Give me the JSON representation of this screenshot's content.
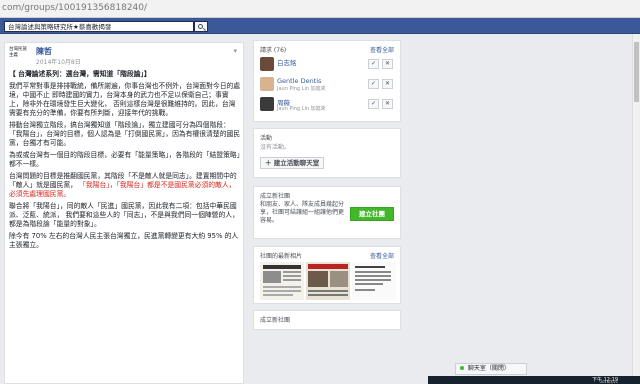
{
  "browser": {
    "url": "com/groups/100191356818240/"
  },
  "header": {
    "search_value": "台灣論述與策略研究所★蔡喜歡揭發"
  },
  "post": {
    "group_name": "台灣民族主義",
    "author": "陳哲",
    "date": "2014年10月8日",
    "paragraphs": [
      "【 台灣論述系列：選台灣，需知道「階段論」】",
      "我們平常對事是排排戰統，備所謝遍，你事台灣也不例外，台灣面對今日的處境，中國不止",
      "即時建國的實力，台灣本身的武力也不足以保衛自己；事實上，除非外在環境發生巨大變化，",
      "否則這樣台灣是很難維持的。因此，台灣需要有充分的準備，你要有所判斷，迎接年代的挑戰。",
      "排動台灣獨立階段，搞台灣獨知道「階段論」，獨立建國可分為四個階段：",
      "「我陽台」，台灣的目標，個人認為是「打倒國民黨」，因為有權很清楚的國民黨，台獨才有可能。",
      "為或或台灣有一個目的階段目標，必要有「能量策略」，各階段的「結盟策略」都不一樣。",
      "台灣問題的目標是推翻國民黨，其階段「不是敵人就是同志」。建置期間中的「敵人」就是國民黨，",
      "「我陽台」，「我陽台」都是不是國民黨必須的敵人，必須先處理國民黨。",
      "聯合將「我陽台」，同的敵人「民進」國民黨，因此我有二項：包括中華民國派、泛藍、統派，",
      "我們要和這些人的「同志」，不是與我們同一個陣營的人，都是為階段論「能量的對象」。",
      "除今有 70% 左右的台灣人民主張台灣獨立，民進黨轉變更有大約 95% 的人主張獨立。"
    ]
  },
  "invites": {
    "title": "請求 (76)",
    "see_all": "查看全部",
    "items": [
      {
        "name": "白志銘",
        "sub": ""
      },
      {
        "name": "Gentle Dentis",
        "sub": "Jaun Ping Lin 加進來"
      },
      {
        "name": "周薇",
        "sub": "Jaun Ping Lin 加進來"
      }
    ]
  },
  "events": {
    "title": "活動",
    "empty": "沒有活動。",
    "create_label": "建立活動聊天室"
  },
  "new_group": {
    "title": "成立新社團",
    "desc": "和朋友、家人、隊友成員幾起分享，社團可結讓組一組讓他們更容易。",
    "button": "建立社團"
  },
  "photos": {
    "title": "社團的最新相片",
    "see_all": "查看全部"
  },
  "tail": {
    "title": "成立新社團"
  },
  "chat": {
    "label": "聊天室（關閉）"
  },
  "tray": {
    "time": "下午 12:19",
    "date": "2016/3/21"
  }
}
